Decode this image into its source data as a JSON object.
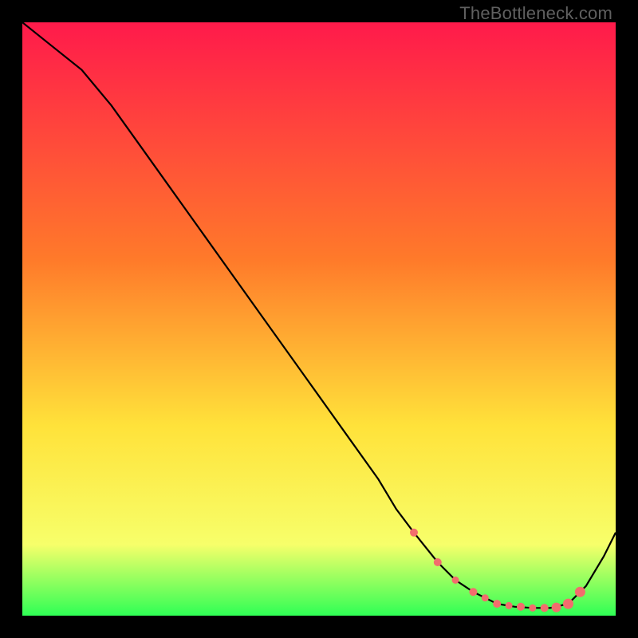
{
  "watermark": "TheBottleneck.com",
  "palette": {
    "gradient_top": "#ff1a4b",
    "gradient_mid1": "#ff7a2a",
    "gradient_mid2": "#ffe23a",
    "gradient_mid3": "#f7ff6a",
    "gradient_bottom": "#2fff55",
    "line": "#000000",
    "marker": "#f26d6d"
  },
  "chart_data": {
    "type": "line",
    "title": "",
    "xlabel": "",
    "ylabel": "",
    "xlim": [
      0,
      100
    ],
    "ylim": [
      0,
      100
    ],
    "grid": false,
    "series": [
      {
        "name": "bottleneck-curve",
        "x": [
          0,
          5,
          10,
          15,
          20,
          25,
          30,
          35,
          40,
          45,
          50,
          55,
          60,
          63,
          66,
          70,
          73,
          76,
          80,
          83,
          86,
          89,
          92,
          95,
          98,
          100
        ],
        "y": [
          100,
          96,
          92,
          86,
          79,
          72,
          65,
          58,
          51,
          44,
          37,
          30,
          23,
          18,
          14,
          9,
          6,
          4,
          2,
          1.5,
          1.3,
          1.3,
          2,
          5,
          10,
          14
        ]
      }
    ],
    "markers": {
      "name": "highlighted-points",
      "x": [
        66,
        70,
        73,
        76,
        78,
        80,
        82,
        84,
        86,
        88,
        90,
        92,
        94
      ],
      "y": [
        14,
        9,
        6,
        4,
        3,
        2,
        1.7,
        1.5,
        1.3,
        1.3,
        1.4,
        2,
        4
      ],
      "radius": [
        5,
        5,
        4.5,
        5,
        4.5,
        5,
        4.5,
        5,
        4.5,
        5,
        6,
        6.5,
        6.5
      ]
    }
  }
}
